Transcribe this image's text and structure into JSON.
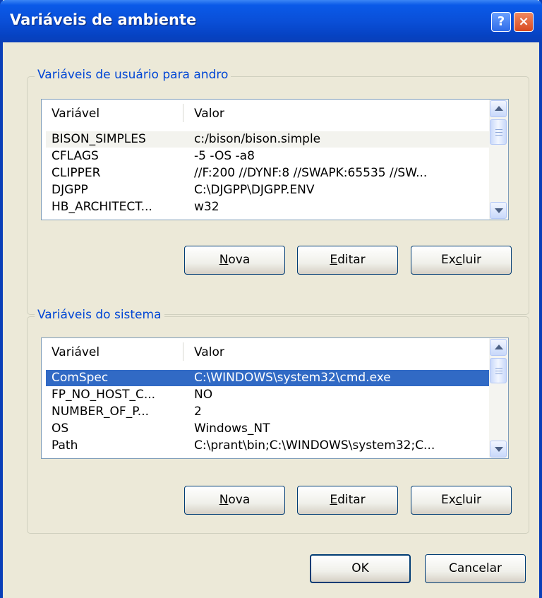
{
  "window": {
    "title": "Variáveis de ambiente",
    "help_icon": "?",
    "close_icon": "×"
  },
  "user_group": {
    "legend": "Variáveis de usuário para andro",
    "columns": [
      "Variável",
      "Valor"
    ],
    "rows": [
      {
        "name": "BISON_SIMPLES",
        "value": "c:/bison/bison.simple"
      },
      {
        "name": "CFLAGS",
        "value": " -5 -OS -a8"
      },
      {
        "name": "CLIPPER",
        "value": "//F:200 //DYNF:8 //SWAPK:65535 //SW..."
      },
      {
        "name": "DJGPP",
        "value": "C:\\DJGPP\\DJGPP.ENV"
      },
      {
        "name": "HB_ARCHITECT...",
        "value": "w32"
      }
    ],
    "buttons": {
      "new": {
        "u": "N",
        "rest": "ova"
      },
      "edit": {
        "u": "E",
        "rest": "ditar"
      },
      "delete": {
        "pre": "Ex",
        "u": "c",
        "rest": "luir"
      }
    }
  },
  "system_group": {
    "legend": "Variáveis do sistema",
    "columns": [
      "Variável",
      "Valor"
    ],
    "rows": [
      {
        "name": "ComSpec",
        "value": "C:\\WINDOWS\\system32\\cmd.exe",
        "selected": true
      },
      {
        "name": "FP_NO_HOST_C...",
        "value": "NO"
      },
      {
        "name": "NUMBER_OF_P...",
        "value": "2"
      },
      {
        "name": "OS",
        "value": "Windows_NT"
      },
      {
        "name": "Path",
        "value": "C:\\prant\\bin;C:\\WINDOWS\\system32;C..."
      }
    ],
    "buttons": {
      "new": {
        "u": "N",
        "rest": "ova"
      },
      "edit": {
        "u": "E",
        "rest": "ditar"
      },
      "delete": {
        "pre": "Ex",
        "u": "c",
        "rest": "luir"
      }
    }
  },
  "footer": {
    "ok": "OK",
    "cancel": "Cancelar"
  }
}
